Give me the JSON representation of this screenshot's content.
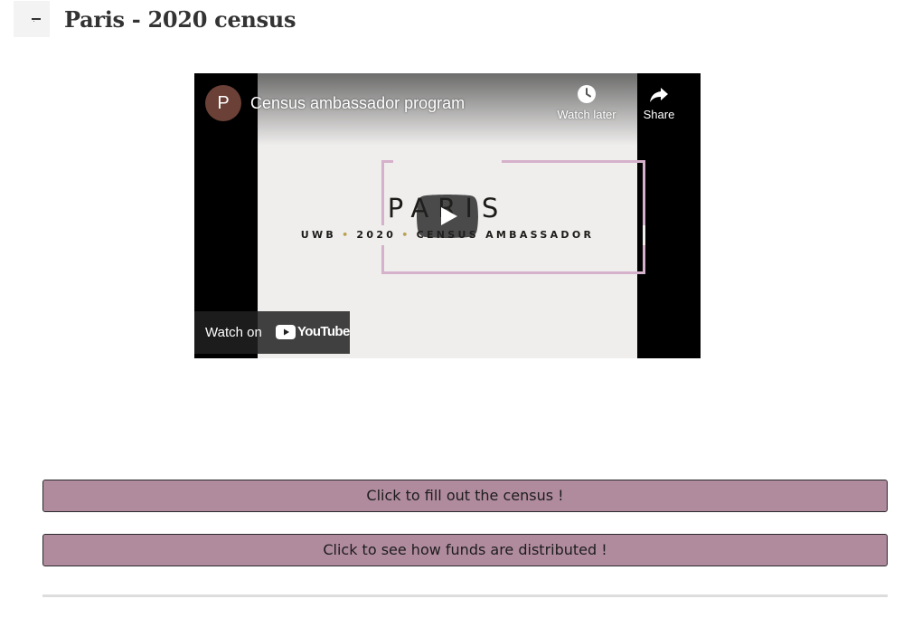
{
  "header": {
    "title": "Paris - 2020 census"
  },
  "video": {
    "channel_initial": "P",
    "title": "Census ambassador program",
    "watch_later_label": "Watch later",
    "share_label": "Share",
    "watch_on_label": "Watch on",
    "youtube_label": "YouTube",
    "thumbnail": {
      "headline": "PARIS",
      "sub_parts": [
        "UWB",
        "2020",
        "CENSUS AMBASSADOR"
      ],
      "separator": "•"
    }
  },
  "buttons": {
    "fill_census": "Click to fill out the census !",
    "funds": "Click to see how funds are distributed !"
  },
  "colors": {
    "button_bg": "#b08b9e",
    "frame": "#d6b1cb",
    "avatar": "#6b4137",
    "youtube_red": "#ff0000"
  }
}
